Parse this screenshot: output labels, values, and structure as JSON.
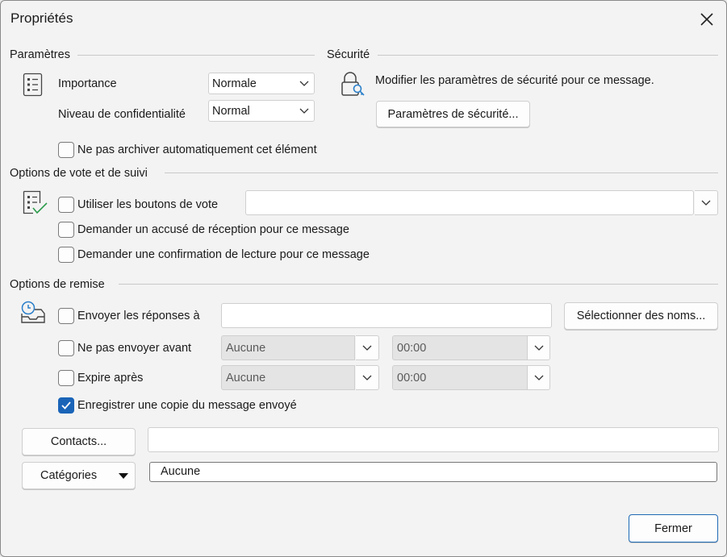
{
  "window": {
    "title": "Propriétés"
  },
  "settings": {
    "title": "Paramètres",
    "importance_label": "Importance",
    "importance_value": "Normale",
    "confidentiality_label": "Niveau de confidentialité",
    "confidentiality_value": "Normal",
    "no_autoarchive_label": "Ne pas archiver automatiquement cet élément",
    "no_autoarchive_checked": false
  },
  "security": {
    "title": "Sécurité",
    "description": "Modifier les paramètres de sécurité pour ce message.",
    "button_label": "Paramètres de sécurité..."
  },
  "voting": {
    "title": "Options de vote et de suivi",
    "use_voting_label": "Utiliser les boutons de vote",
    "use_voting_checked": false,
    "voting_value": "",
    "delivery_receipt_label": "Demander un accusé de réception pour ce message",
    "delivery_receipt_checked": false,
    "read_receipt_label": "Demander une confirmation de lecture pour ce message",
    "read_receipt_checked": false
  },
  "delivery": {
    "title": "Options de remise",
    "reply_to_label": "Envoyer les réponses à",
    "reply_to_checked": false,
    "reply_to_value": "",
    "select_names_label": "Sélectionner des noms...",
    "defer_label": "Ne pas envoyer avant",
    "defer_checked": false,
    "defer_date": "Aucune",
    "defer_time": "00:00",
    "expires_label": "Expire après",
    "expires_checked": false,
    "expires_date": "Aucune",
    "expires_time": "00:00",
    "save_copy_label": "Enregistrer une copie du message envoyé",
    "save_copy_checked": true
  },
  "bottom": {
    "contacts_label": "Contacts...",
    "contacts_value": "",
    "categories_label": "Catégories",
    "categories_value": "Aucune",
    "close_label": "Fermer"
  },
  "colors": {
    "accent": "#1a64b8",
    "background": "#f3f3f3"
  },
  "icons": [
    "close-icon",
    "chevron-down-icon",
    "settings-list-icon",
    "lock-key-icon",
    "vote-checklist-icon",
    "clock-tray-icon",
    "checkmark-icon",
    "caret-down-icon"
  ]
}
